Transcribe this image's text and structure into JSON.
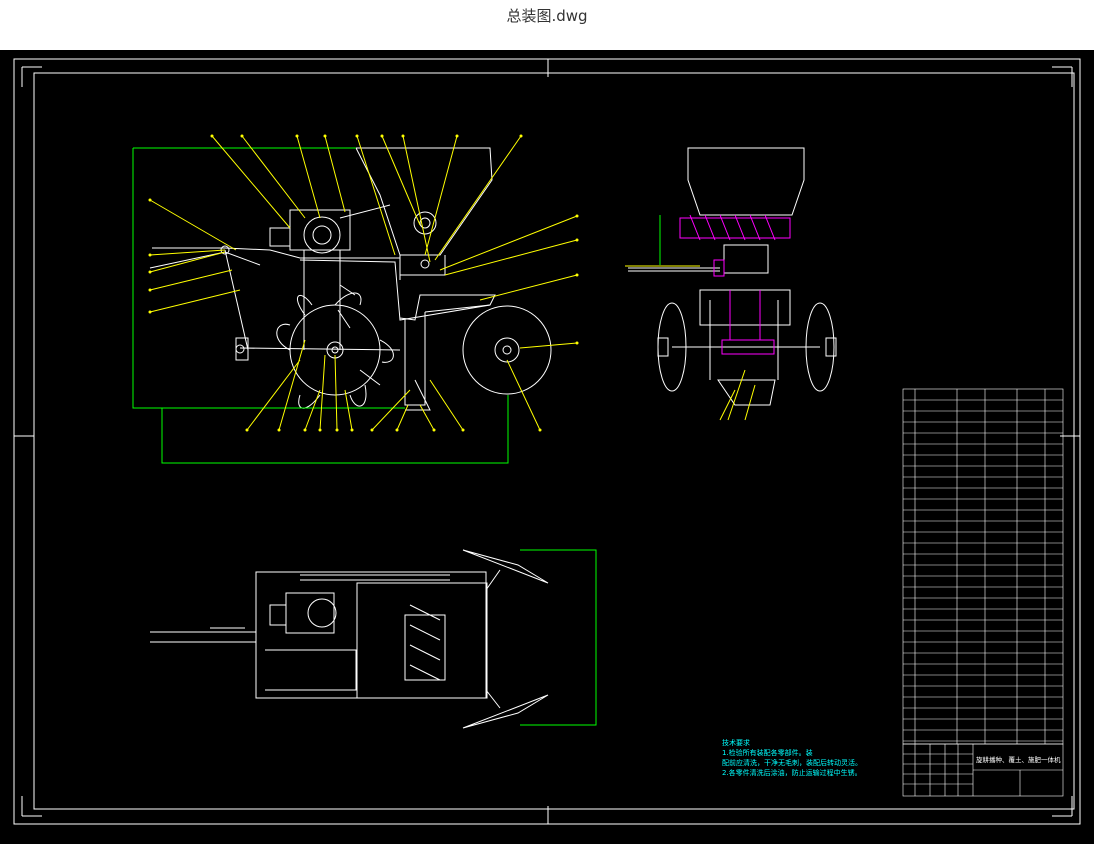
{
  "window": {
    "title": "总装图.dwg"
  },
  "drawing": {
    "tech_notes": {
      "heading": "技术要求",
      "line1": "1.检验所有装配各零部件。装",
      "line2": "配前应清洗，干净无毛刺，装配后转动灵活。",
      "line3": "2.各零件清洗后涂油，防止运输过程中生锈。"
    },
    "title_block": {
      "title": "旋耕播种、覆土、施肥一体机"
    },
    "colors": {
      "background": "#000000",
      "frame": "#ffffff",
      "machine": "#ffffff",
      "dimension": "#00ff00",
      "leader": "#ffff00",
      "part": "#ff00ff",
      "notes": "#00ffff"
    }
  }
}
